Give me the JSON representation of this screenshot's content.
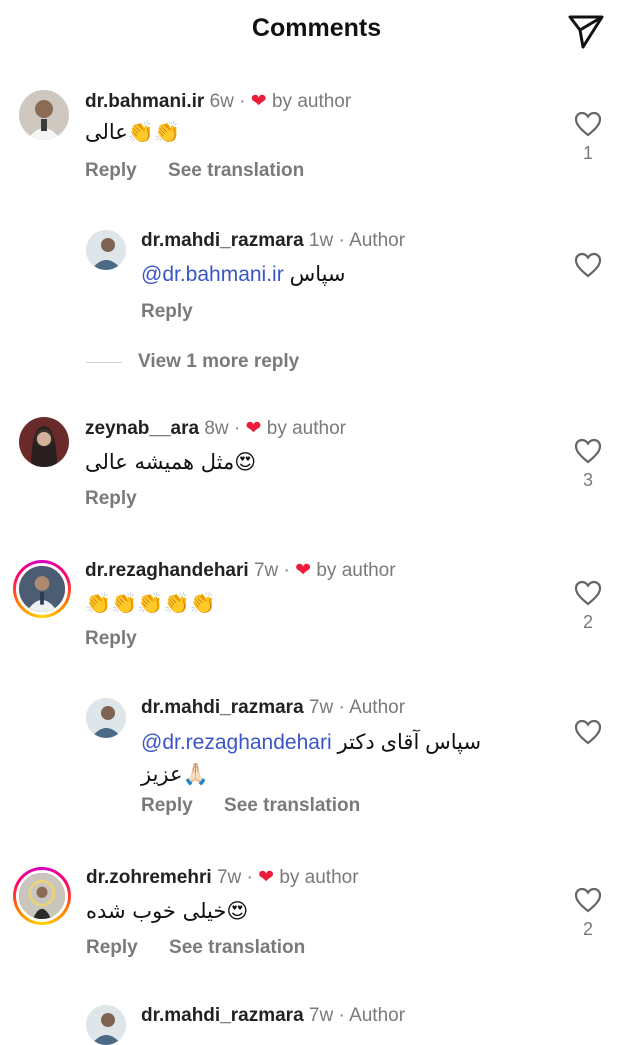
{
  "header": {
    "title": "Comments",
    "share_icon": "paper-plane-icon"
  },
  "comments": [
    {
      "username": "dr.bahmani.ir",
      "time": "6w",
      "by_author": "by author",
      "text": "عالی👏👏",
      "actions": [
        "Reply",
        "See translation"
      ],
      "likes": "1"
    },
    {
      "username": "dr.mahdi_razmara",
      "time": "1w",
      "role": "Author",
      "mention": "@dr.bahmani.ir",
      "text": "سپاس",
      "actions": [
        "Reply"
      ],
      "likes": ""
    },
    {
      "view_more": "View 1 more reply"
    },
    {
      "username": "zeynab__ara",
      "time": "8w",
      "by_author": "by author",
      "text": "مثل همیشه عالی😍",
      "actions": [
        "Reply"
      ],
      "likes": "3"
    },
    {
      "username": "dr.rezaghandehari",
      "time": "7w",
      "by_author": "by author",
      "text": "👏👏👏👏👏",
      "actions": [
        "Reply"
      ],
      "likes": "2"
    },
    {
      "username": "dr.mahdi_razmara",
      "time": "7w",
      "role": "Author",
      "mention": "@dr.rezaghandehari",
      "text": "سپاس آقای دکتر",
      "text2": "عزیز🙏🏻",
      "actions": [
        "Reply",
        "See translation"
      ],
      "likes": ""
    },
    {
      "username": "dr.zohremehri",
      "time": "7w",
      "by_author": "by author",
      "text": "خیلی خوب شده😍",
      "actions": [
        "Reply",
        "See translation"
      ],
      "likes": "2"
    },
    {
      "username": "dr.mahdi_razmara",
      "time": "7w",
      "role": "Author"
    }
  ],
  "colors": {
    "heart": "#ed1b3a",
    "mention": "#3b55c9",
    "muted": "#7a7a7a"
  }
}
